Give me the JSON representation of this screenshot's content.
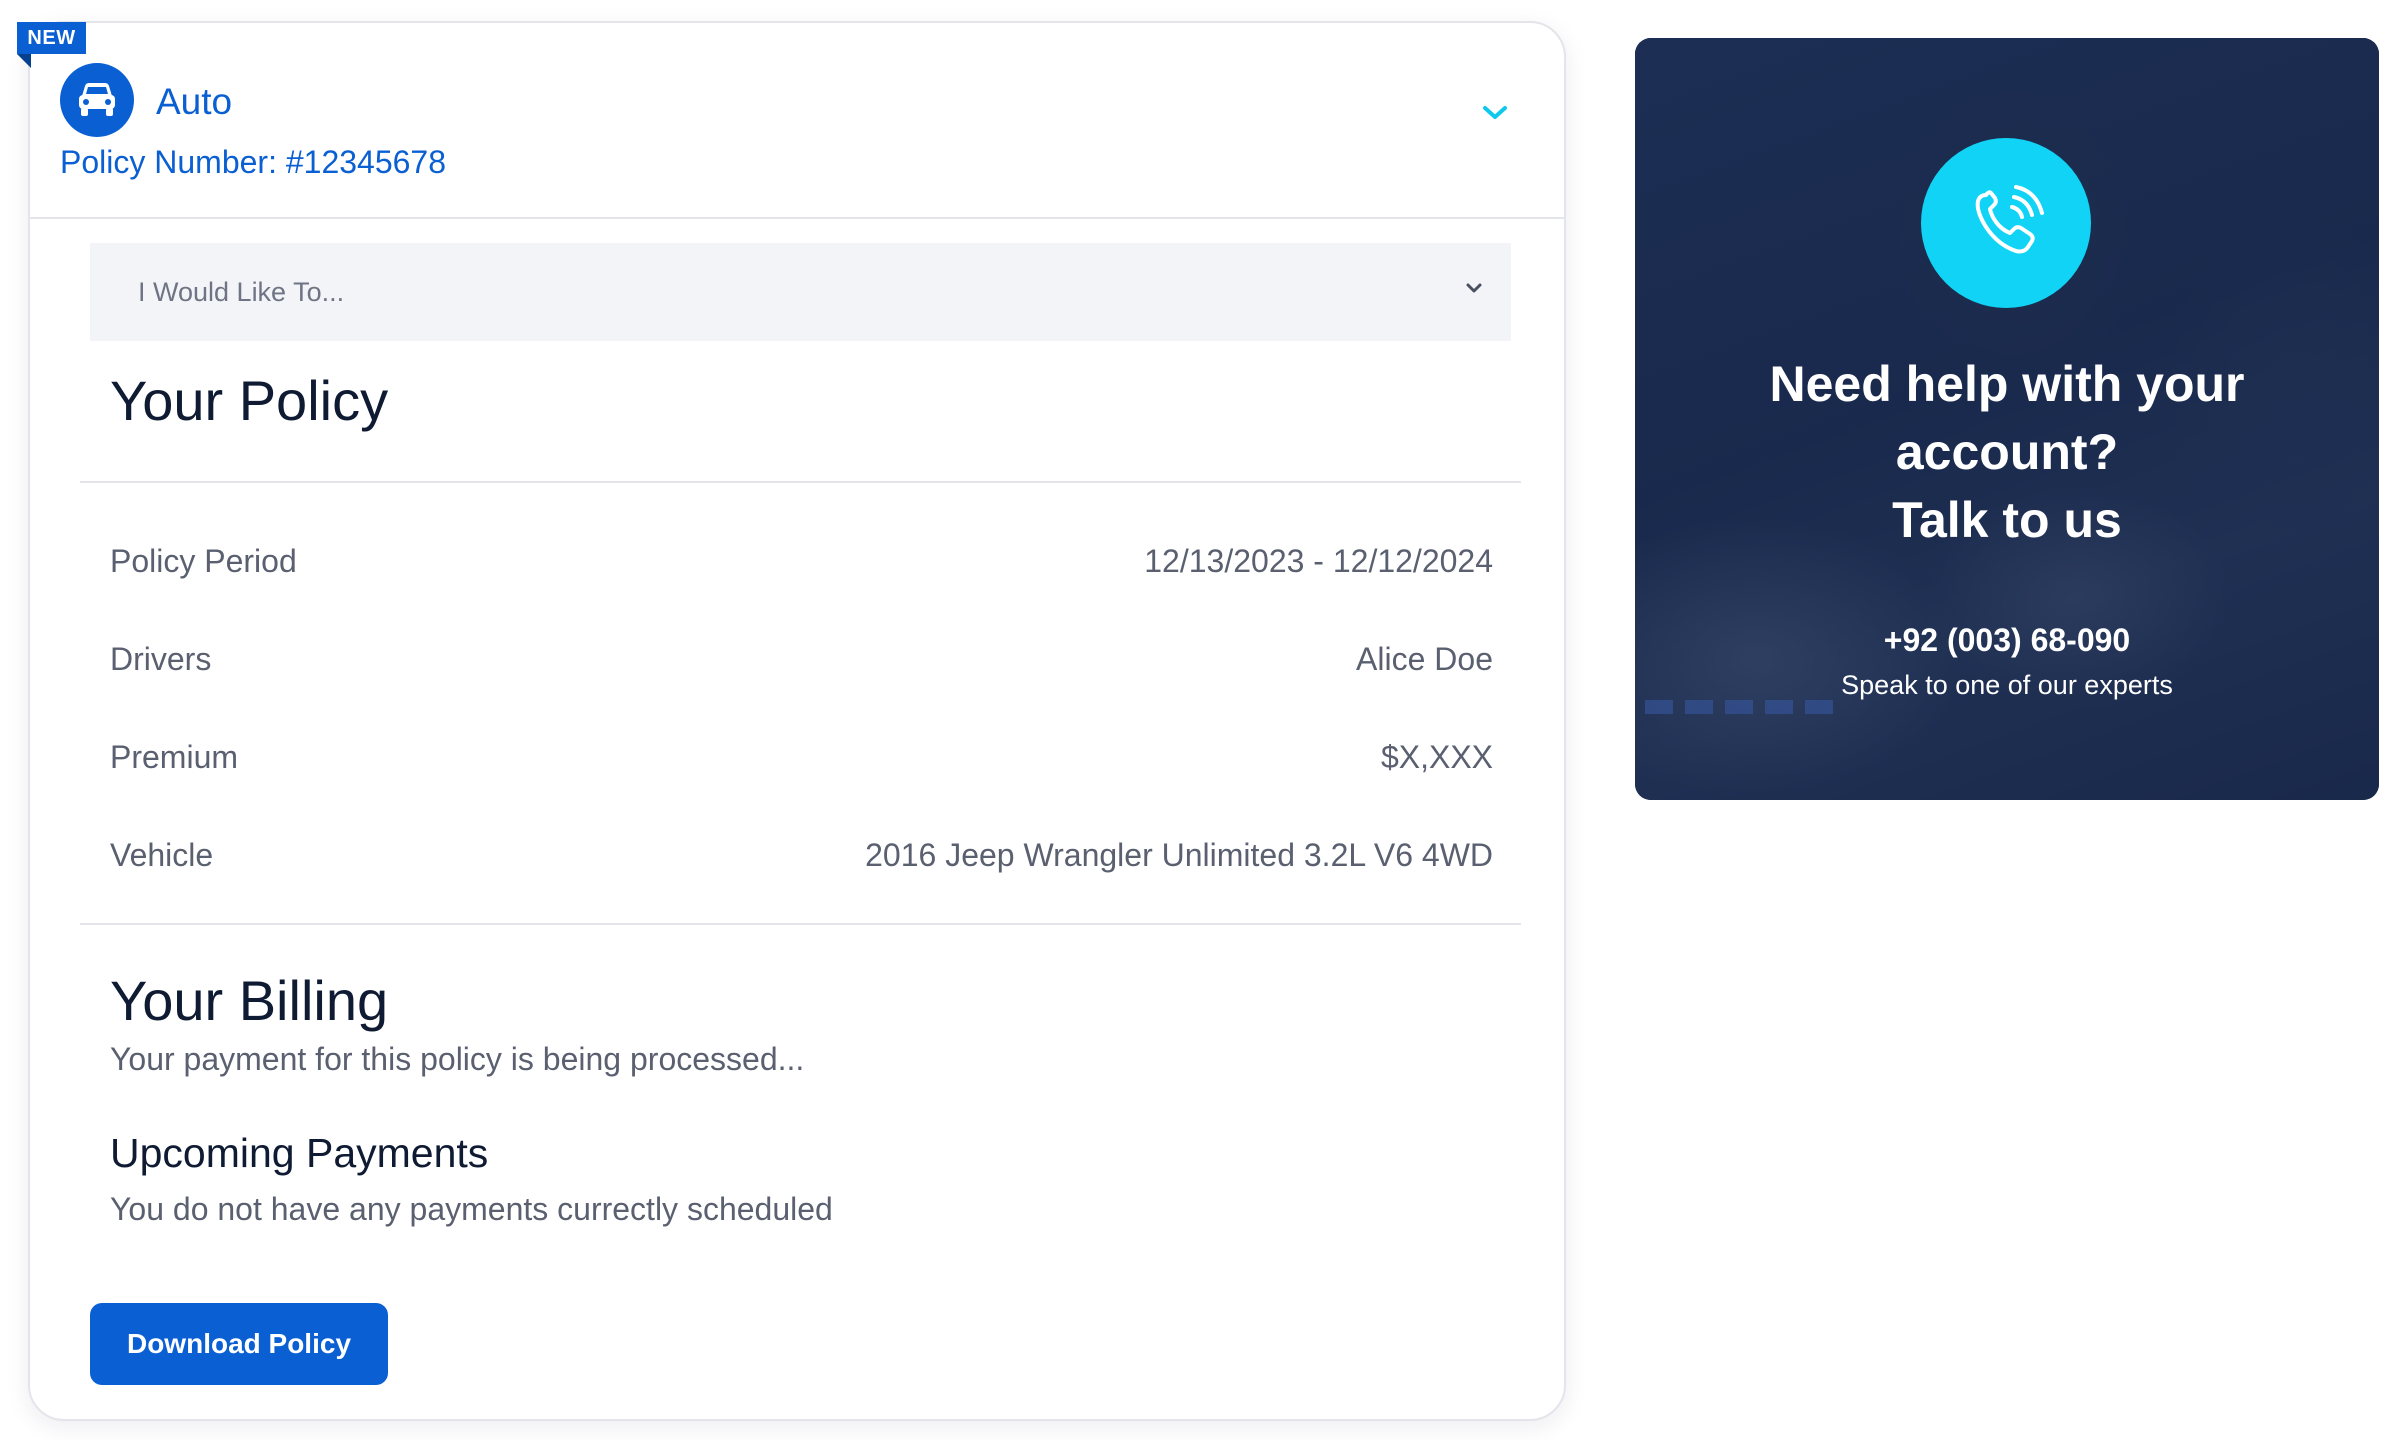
{
  "policy_card": {
    "badge": "NEW",
    "product": "Auto",
    "policy_number": "Policy Number: #12345678",
    "icons": {
      "product": "car-icon",
      "expand": "chevron-down-icon"
    }
  },
  "action_select": {
    "placeholder": "I Would Like To...",
    "icon": "chevron-down-icon"
  },
  "your_policy": {
    "title": "Your Policy",
    "rows": [
      {
        "label": "Policy Period",
        "value": "12/13/2023 - 12/12/2024"
      },
      {
        "label": "Drivers",
        "value": "Alice Doe"
      },
      {
        "label": "Premium",
        "value": "$X,XXX"
      },
      {
        "label": "Vehicle",
        "value": "2016 Jeep Wrangler Unlimited 3.2L V6 4WD"
      }
    ]
  },
  "your_billing": {
    "title": "Your Billing",
    "status": "Your payment for this policy is being processed...",
    "upcoming_title": "Upcoming Payments",
    "upcoming_text": "You do not have any payments currectly scheduled"
  },
  "actions": {
    "download_label": "Download Policy"
  },
  "help_card": {
    "title_line1": "Need help with your",
    "title_line2": "account?",
    "title_line3": "Talk to us",
    "phone": "+92 (003) 68-090",
    "subtitle": "Speak to one of our experts",
    "icon": "phone-call-icon"
  },
  "colors": {
    "brand_blue": "#0a5fd3",
    "accent_cyan": "#10d3f5",
    "heading": "#0f1b33",
    "muted_text": "#5a6070",
    "help_bg": "#1d2d4f"
  }
}
